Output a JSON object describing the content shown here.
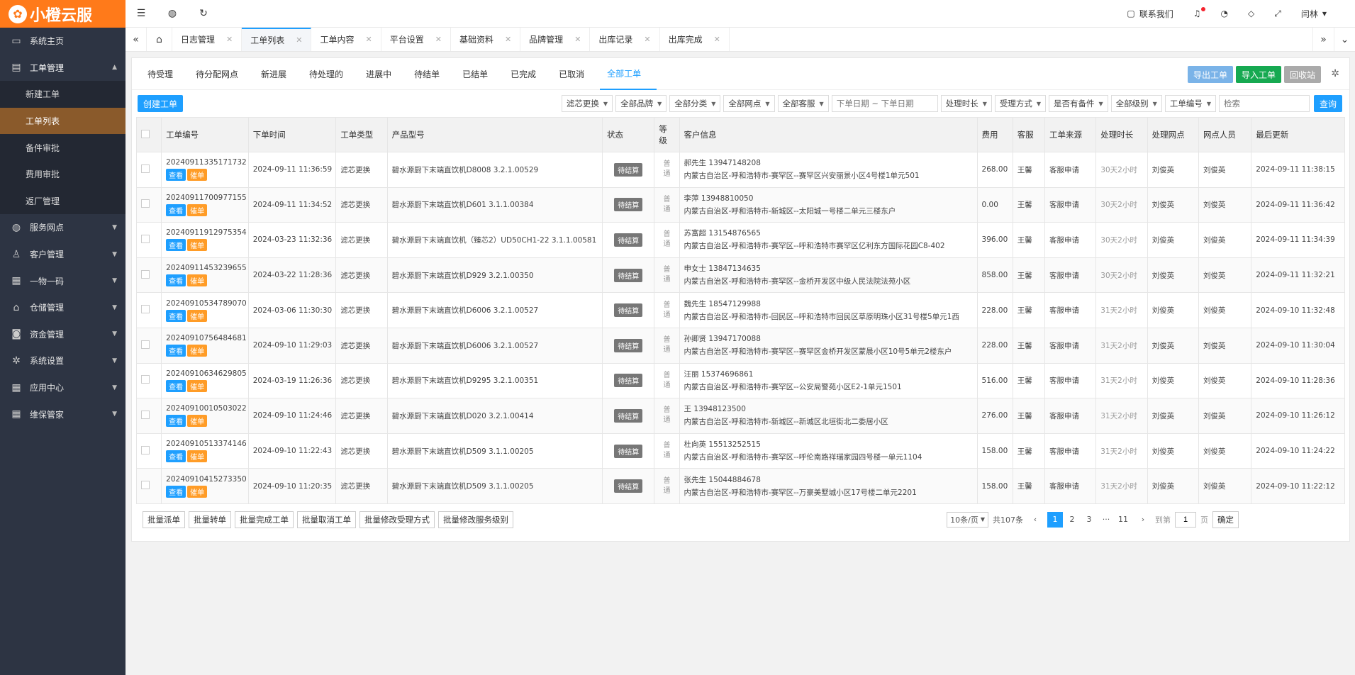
{
  "app": {
    "logo_text": "小橙云服",
    "logo_mark": "✿"
  },
  "sidebar": {
    "items": [
      {
        "label": "系统主页",
        "icon": "monitor-icon",
        "glyph": "▭"
      },
      {
        "label": "工单管理",
        "icon": "document-icon",
        "glyph": "▤",
        "open": true,
        "children": [
          {
            "label": "新建工单"
          },
          {
            "label": "工单列表",
            "active": true
          },
          {
            "label": "备件审批"
          },
          {
            "label": "费用审批"
          },
          {
            "label": "返厂管理"
          }
        ]
      },
      {
        "label": "服务网点",
        "icon": "globe-icon",
        "glyph": "◍"
      },
      {
        "label": "客户管理",
        "icon": "user-icon",
        "glyph": "♙"
      },
      {
        "label": "一物一码",
        "icon": "grid-icon",
        "glyph": "▦"
      },
      {
        "label": "仓储管理",
        "icon": "bank-icon",
        "glyph": "⌂"
      },
      {
        "label": "资金管理",
        "icon": "money-icon",
        "glyph": "◙"
      },
      {
        "label": "系统设置",
        "icon": "gear-icon",
        "glyph": "✲"
      },
      {
        "label": "应用中心",
        "icon": "grid-icon",
        "glyph": "▦"
      },
      {
        "label": "维保管家",
        "icon": "grid-icon",
        "glyph": "▦"
      }
    ]
  },
  "header": {
    "contact_label": "联系我们",
    "user_name": "闫林"
  },
  "tabs": [
    {
      "label": "日志管理"
    },
    {
      "label": "工单列表",
      "active": true
    },
    {
      "label": "工单内容"
    },
    {
      "label": "平台设置"
    },
    {
      "label": "基础资料"
    },
    {
      "label": "品牌管理"
    },
    {
      "label": "出库记录"
    },
    {
      "label": "出库完成"
    }
  ],
  "status_tabs": [
    "待受理",
    "待分配网点",
    "新进展",
    "待处理的",
    "进展中",
    "待结单",
    "已结单",
    "已完成",
    "已取消",
    "全部工单"
  ],
  "status_active_index": 9,
  "top_buttons": {
    "export": "导出工单",
    "import": "导入工单",
    "recycle": "回收站"
  },
  "toolbar": {
    "create": "创建工单",
    "filters": [
      "滤芯更换",
      "全部品牌",
      "全部分类",
      "全部网点",
      "全部客服"
    ],
    "date_placeholder": "下单日期 ~ 下单日期",
    "filters2": [
      "处理时长",
      "受理方式",
      "是否有备件",
      "全部级别",
      "工单编号"
    ],
    "search_placeholder": "检索",
    "search_button": "查询"
  },
  "table": {
    "headers": [
      "工单编号",
      "下单时间",
      "工单类型",
      "产品型号",
      "状态",
      "等级",
      "客户信息",
      "费用",
      "客服",
      "工单来源",
      "处理时长",
      "处理网点",
      "网点人员",
      "最后更新"
    ],
    "view_label": "查看",
    "urge_label": "催单",
    "rows": [
      {
        "id": "20240911335171732",
        "time": "2024-09-11 11:36:59",
        "type": "滤芯更换",
        "model": "碧水源厨下末端直饮机D8008 3.2.1.00529",
        "status": "待结算",
        "level": "普通",
        "customer": "郝先生 13947148208",
        "address": "内蒙古自治区-呼和浩特市-赛罕区--赛罕区兴安丽景小区4号楼1单元501",
        "fee": "268.00",
        "cs": "王馨",
        "source": "客服申请",
        "duration": "30天2小时",
        "outlet": "刘俊英",
        "staff": "刘俊英",
        "updated": "2024-09-11 11:38:15"
      },
      {
        "id": "20240911700977155",
        "time": "2024-09-11 11:34:52",
        "type": "滤芯更换",
        "model": "碧水源厨下末端直饮机D601 3.1.1.00384",
        "status": "待结算",
        "level": "普通",
        "customer": "李萍 13948810050",
        "address": "内蒙古自治区-呼和浩特市-新城区--太阳城一号楼二单元三楼东户",
        "fee": "0.00",
        "cs": "王馨",
        "source": "客服申请",
        "duration": "30天2小时",
        "outlet": "刘俊英",
        "staff": "刘俊英",
        "updated": "2024-09-11 11:36:42"
      },
      {
        "id": "20240911912975354",
        "time": "2024-03-23 11:32:36",
        "type": "滤芯更换",
        "model": "碧水源厨下末端直饮机（臻芯2）UD50CH1-22 3.1.1.00581",
        "status": "待结算",
        "level": "普通",
        "customer": "苏富超 13154876565",
        "address": "内蒙古自治区-呼和浩特市-赛罕区--呼和浩特市赛罕区亿利东方国际花园C8-402",
        "fee": "396.00",
        "cs": "王馨",
        "source": "客服申请",
        "duration": "30天2小时",
        "outlet": "刘俊英",
        "staff": "刘俊英",
        "updated": "2024-09-11 11:34:39"
      },
      {
        "id": "20240911453239655",
        "time": "2024-03-22 11:28:36",
        "type": "滤芯更换",
        "model": "碧水源厨下末端直饮机D929 3.2.1.00350",
        "status": "待结算",
        "level": "普通",
        "customer": "申女士 13847134635",
        "address": "内蒙古自治区-呼和浩特市-赛罕区--金桥开发区中级人民法院法苑小区",
        "fee": "858.00",
        "cs": "王馨",
        "source": "客服申请",
        "duration": "30天2小时",
        "outlet": "刘俊英",
        "staff": "刘俊英",
        "updated": "2024-09-11 11:32:21"
      },
      {
        "id": "20240910534789070",
        "time": "2024-03-06 11:30:30",
        "type": "滤芯更换",
        "model": "碧水源厨下末端直饮机D6006 3.2.1.00527",
        "status": "待结算",
        "level": "普通",
        "customer": "魏先生 18547129988",
        "address": "内蒙古自治区-呼和浩特市-回民区--呼和浩特市回民区草原明珠小区31号楼5单元1西",
        "fee": "228.00",
        "cs": "王馨",
        "source": "客服申请",
        "duration": "31天2小时",
        "outlet": "刘俊英",
        "staff": "刘俊英",
        "updated": "2024-09-10 11:32:48"
      },
      {
        "id": "20240910756484681",
        "time": "2024-09-10 11:29:03",
        "type": "滤芯更换",
        "model": "碧水源厨下末端直饮机D6006 3.2.1.00527",
        "status": "待结算",
        "level": "普通",
        "customer": "孙卿贤 13947170088",
        "address": "内蒙古自治区-呼和浩特市-赛罕区--赛罕区金桥开发区蒙晨小区10号5单元2楼东户",
        "fee": "228.00",
        "cs": "王馨",
        "source": "客服申请",
        "duration": "31天2小时",
        "outlet": "刘俊英",
        "staff": "刘俊英",
        "updated": "2024-09-10 11:30:04"
      },
      {
        "id": "20240910634629805",
        "time": "2024-03-19 11:26:36",
        "type": "滤芯更换",
        "model": "碧水源厨下末端直饮机D9295 3.2.1.00351",
        "status": "待结算",
        "level": "普通",
        "customer": "汪丽 15374696861",
        "address": "内蒙古自治区-呼和浩特市-赛罕区--公安局警苑小区E2-1单元1501",
        "fee": "516.00",
        "cs": "王馨",
        "source": "客服申请",
        "duration": "31天2小时",
        "outlet": "刘俊英",
        "staff": "刘俊英",
        "updated": "2024-09-10 11:28:36"
      },
      {
        "id": "20240910010503022",
        "time": "2024-09-10 11:24:46",
        "type": "滤芯更换",
        "model": "碧水源厨下末端直饮机D020 3.2.1.00414",
        "status": "待结算",
        "level": "普通",
        "customer": "王 13948123500",
        "address": "内蒙古自治区-呼和浩特市-新城区--新城区北垣街北二委居小区",
        "fee": "276.00",
        "cs": "王馨",
        "source": "客服申请",
        "duration": "31天2小时",
        "outlet": "刘俊英",
        "staff": "刘俊英",
        "updated": "2024-09-10 11:26:12"
      },
      {
        "id": "20240910513374146",
        "time": "2024-09-10 11:22:43",
        "type": "滤芯更换",
        "model": "碧水源厨下末端直饮机D509 3.1.1.00205",
        "status": "待结算",
        "level": "普通",
        "customer": "杜向英 15513252515",
        "address": "内蒙古自治区-呼和浩特市-赛罕区--呼伦南路祥瑞家园四号楼一单元1104",
        "fee": "158.00",
        "cs": "王馨",
        "source": "客服申请",
        "duration": "31天2小时",
        "outlet": "刘俊英",
        "staff": "刘俊英",
        "updated": "2024-09-10 11:24:22"
      },
      {
        "id": "20240910415273350",
        "time": "2024-09-10 11:20:35",
        "type": "滤芯更换",
        "model": "碧水源厨下末端直饮机D509 3.1.1.00205",
        "status": "待结算",
        "level": "普通",
        "customer": "张先生 15044884678",
        "address": "内蒙古自治区-呼和浩特市-赛罕区--万豪美墅城小区17号楼二单元2201",
        "fee": "158.00",
        "cs": "王馨",
        "source": "客服申请",
        "duration": "31天2小时",
        "outlet": "刘俊英",
        "staff": "刘俊英",
        "updated": "2024-09-10 11:22:12"
      }
    ]
  },
  "footer": {
    "batch_buttons": [
      "批量派单",
      "批量转单",
      "批量完成工单",
      "批量取消工单",
      "批量修改受理方式",
      "批量修改服务级别"
    ],
    "page_size": "10条/页",
    "total": "共107条",
    "pages": [
      "1",
      "2",
      "3",
      "···",
      "11"
    ],
    "current_page": "1",
    "goto_label": "到第",
    "goto_value": "1",
    "page_unit": "页",
    "confirm": "确定"
  },
  "colors": {
    "brand": "#ff7a1a",
    "accent": "#1e9fff",
    "sidebar": "#2d3443"
  }
}
